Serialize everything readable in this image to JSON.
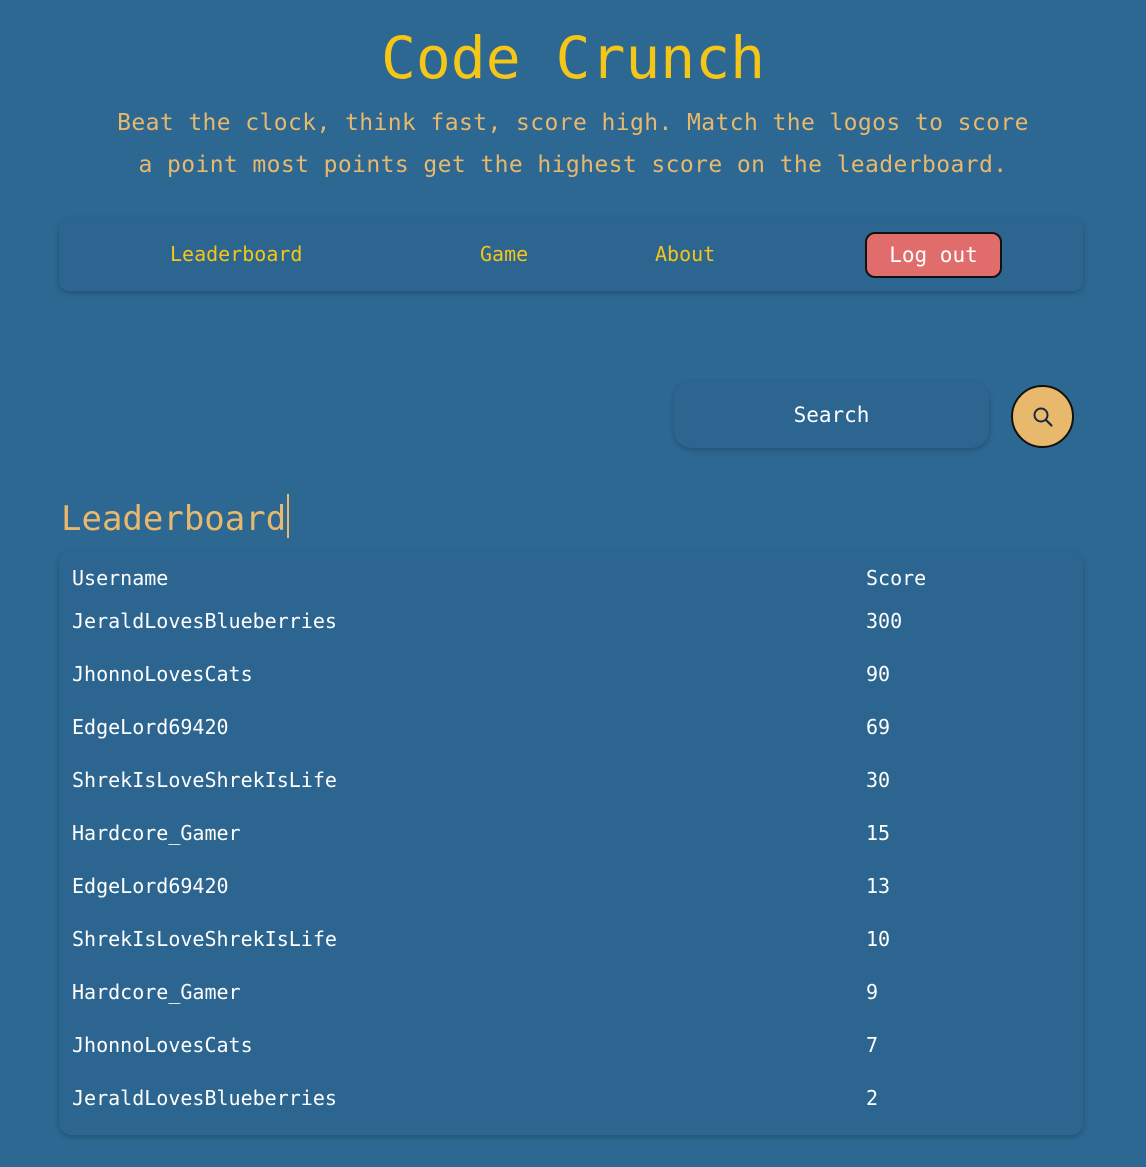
{
  "header": {
    "title": "Code Crunch",
    "tagline_line1": "Beat the clock, think fast, score high. Match the logos to score",
    "tagline_line2": "a point most points get the highest score on the leaderboard."
  },
  "nav": {
    "leaderboard": "Leaderboard",
    "game": "Game",
    "about": "About",
    "logout": "Log out"
  },
  "search": {
    "placeholder": "Search",
    "button_icon": "search-icon"
  },
  "leaderboard": {
    "heading": "Leaderboard",
    "columns": [
      "Username",
      "Score"
    ],
    "rows": [
      {
        "username": "JeraldLovesBlueberries",
        "score": "300"
      },
      {
        "username": "JhonnoLovesCats",
        "score": "90"
      },
      {
        "username": "EdgeLord69420",
        "score": "69"
      },
      {
        "username": "ShrekIsLoveShrekIsLife",
        "score": "30"
      },
      {
        "username": "Hardcore_Gamer",
        "score": "15"
      },
      {
        "username": "EdgeLord69420",
        "score": "13"
      },
      {
        "username": "ShrekIsLoveShrekIsLife",
        "score": "10"
      },
      {
        "username": "Hardcore_Gamer",
        "score": "9"
      },
      {
        "username": "JhonnoLovesCats",
        "score": "7"
      },
      {
        "username": "JeraldLovesBlueberries",
        "score": "2"
      }
    ]
  },
  "colors": {
    "background": "#2c6892",
    "panel": "#2b6590",
    "title_yellow": "#f5c518",
    "accent_gold": "#e8b86d",
    "logout_red": "#e06c6c",
    "text_white": "#ffffff"
  }
}
